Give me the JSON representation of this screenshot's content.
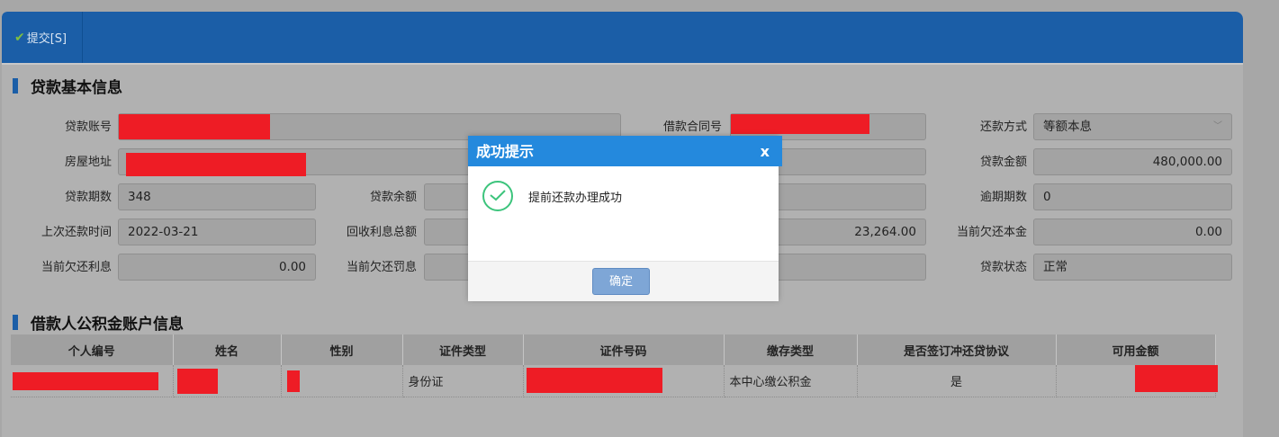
{
  "toolbar": {
    "submit_label": "提交[S]"
  },
  "sections": {
    "loan_info_title": "贷款基本信息",
    "account_info_title": "借款人公积金账户信息"
  },
  "loan": {
    "account_no_label": "贷款账号",
    "contract_no_label": "借款合同号",
    "repay_method_label": "还款方式",
    "repay_method_value": "等额本息",
    "address_label": "房屋地址",
    "loan_amount_label": "贷款金额",
    "loan_amount_value": "480,000.00",
    "term_label": "贷款期数",
    "term_value": "348",
    "balance_label": "贷款余额",
    "overdue_periods_label": "逾期期数",
    "overdue_periods_value": "0",
    "last_repay_label": "上次还款时间",
    "last_repay_value": "2022-03-21",
    "interest_total_label": "回收利息总额",
    "mid_value": "23,264.00",
    "current_principal_label": "当前欠还本金",
    "current_principal_value": "0.00",
    "current_interest_label": "当前欠还利息",
    "current_interest_value": "0.00",
    "current_penalty_label": "当前欠还罚息",
    "status_label": "贷款状态",
    "status_value": "正常"
  },
  "table": {
    "columns": [
      "个人编号",
      "姓名",
      "性别",
      "证件类型",
      "证件号码",
      "缴存类型",
      "是否签订冲还贷协议",
      "可用金额"
    ],
    "rows": [
      {
        "id_type": "身份证",
        "deposit_type": "本中心缴公积金",
        "agreement": "是"
      }
    ]
  },
  "dialog": {
    "title": "成功提示",
    "close": "x",
    "message": "提前还款办理成功",
    "ok_label": "确定"
  },
  "colors": {
    "toolbar": "#1b5ea7",
    "dialog_header": "#2489dd",
    "success": "#3cc47c",
    "redaction": "#ee1c25"
  }
}
